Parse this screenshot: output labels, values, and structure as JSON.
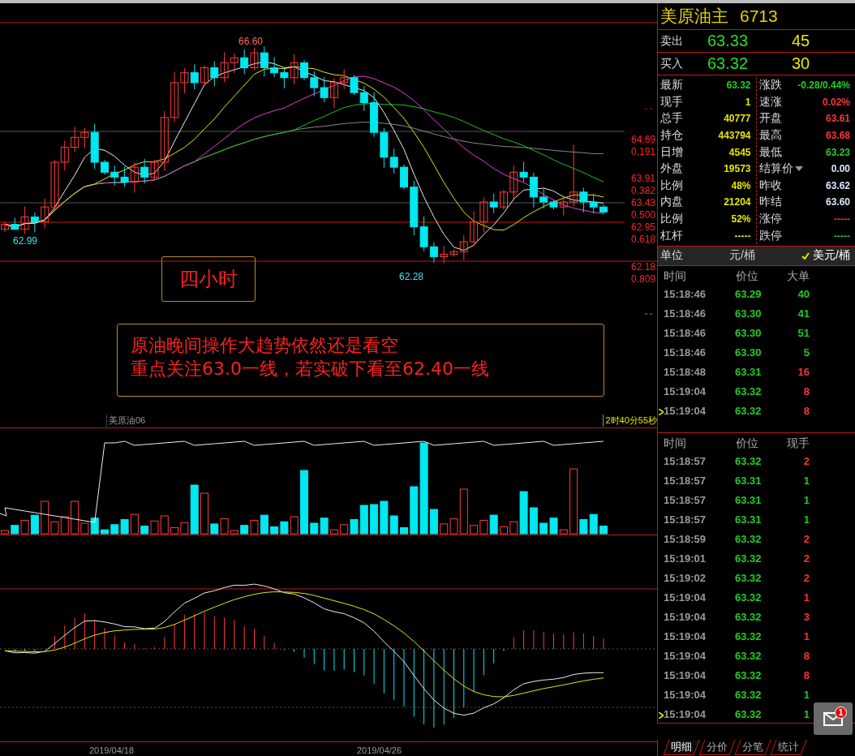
{
  "chart": {
    "extreme_labels": [
      {
        "kind": "high",
        "text": "66.60"
      },
      {
        "kind": "low",
        "text": "62.99"
      },
      {
        "kind": "low",
        "text": "62.28"
      }
    ],
    "fib_levels": [
      {
        "price": "64.69",
        "ratio": "0.191"
      },
      {
        "price": "63.91",
        "ratio": "0.382"
      },
      {
        "price": "63.43",
        "ratio": "0.500"
      },
      {
        "price": "62.95",
        "ratio": "0.618"
      },
      {
        "price": "62.18",
        "ratio": "0.809"
      }
    ],
    "timeframe_label": "四小时",
    "note_lines": [
      "原油晚间操作大趋势依然还是看空",
      "重点关注63.0一线，若实破下看至62.40一线"
    ]
  },
  "status_strip": {
    "symbol": "美原油06",
    "countdown": "2时40分55秒"
  },
  "date_axis": [
    "2019/04/18",
    "2019/04/26"
  ],
  "quote": {
    "name": "美原油主",
    "code": "6713",
    "ask": {
      "label": "卖出",
      "price": "63.33",
      "volume": "45"
    },
    "bid": {
      "label": "买入",
      "price": "63.32",
      "volume": "30"
    },
    "stats": [
      {
        "left": {
          "label": "最新",
          "value": "63.32",
          "color": "#22cc22"
        },
        "right": {
          "label": "涨跌",
          "value": "-0.28/0.44%",
          "color": "#22cc22",
          "kind": "plain"
        }
      },
      {
        "left": {
          "label": "现手",
          "value": "1",
          "color": "#e6e600"
        },
        "right": {
          "label": "速涨",
          "value": "0.02%",
          "color": "#ff3333",
          "kind": "plain"
        }
      },
      {
        "left": {
          "label": "总手",
          "value": "40777",
          "color": "#e6e600"
        },
        "right": {
          "label": "开盘",
          "value": "63.61",
          "color": "#ff3333",
          "kind": "plain"
        }
      },
      {
        "left": {
          "label": "持仓",
          "value": "443794",
          "color": "#e6e600"
        },
        "right": {
          "label": "最高",
          "value": "63.68",
          "color": "#ff3333",
          "kind": "plain"
        }
      },
      {
        "left": {
          "label": "日增",
          "value": "4545",
          "color": "#e6e600"
        },
        "right": {
          "label": "最低",
          "value": "63.23",
          "color": "#22cc22",
          "kind": "plain"
        }
      },
      {
        "left": {
          "label": "外盘",
          "value": "19573",
          "color": "#e6e600"
        },
        "right": {
          "label": "结算价",
          "value": "0.00",
          "color": "#dce8ff",
          "kind": "dropdown"
        }
      },
      {
        "left": {
          "label": "比例",
          "value": "48%",
          "color": "#e6e600"
        },
        "right": {
          "label": "昨收",
          "value": "63.62",
          "color": "#dce8ff",
          "kind": "plain"
        }
      },
      {
        "left": {
          "label": "内盘",
          "value": "21204",
          "color": "#e6e600"
        },
        "right": {
          "label": "昨结",
          "value": "63.60",
          "color": "#dce8ff",
          "kind": "plain"
        }
      },
      {
        "left": {
          "label": "比例",
          "value": "52%",
          "color": "#e6e600"
        },
        "right": {
          "label": "涨停",
          "value": "-----",
          "color": "#ff3333",
          "kind": "plain"
        }
      },
      {
        "left": {
          "label": "杠杆",
          "value": "-----",
          "color": "#e6e600"
        },
        "right": {
          "label": "跌停",
          "value": "-----",
          "color": "#22cc22",
          "kind": "plain"
        }
      }
    ],
    "unit": {
      "label": "单位",
      "options": [
        {
          "label": "元/桶",
          "selected": false
        },
        {
          "label": "美元/桶",
          "selected": true
        }
      ]
    }
  },
  "big_orders": {
    "columns": [
      "时间",
      "价位",
      "大单"
    ],
    "rows": [
      {
        "time": "15:18:46",
        "price": "63.29",
        "qty": "40",
        "color": "#22cc22",
        "current": false
      },
      {
        "time": "15:18:46",
        "price": "63.30",
        "qty": "41",
        "color": "#22cc22",
        "current": false
      },
      {
        "time": "15:18:46",
        "price": "63.30",
        "qty": "51",
        "color": "#22cc22",
        "current": false
      },
      {
        "time": "15:18:46",
        "price": "63.30",
        "qty": "5",
        "color": "#22cc22",
        "current": false
      },
      {
        "time": "15:18:48",
        "price": "63.31",
        "qty": "16",
        "color": "#ff3333",
        "current": false
      },
      {
        "time": "15:19:04",
        "price": "63.32",
        "qty": "8",
        "color": "#ff3333",
        "current": false
      },
      {
        "time": "15:19:04",
        "price": "63.32",
        "qty": "8",
        "color": "#ff3333",
        "current": true
      }
    ]
  },
  "ticks": {
    "columns": [
      "时间",
      "价位",
      "现手"
    ],
    "rows": [
      {
        "time": "15:18:57",
        "price": "63.32",
        "qty": "2",
        "color": "#ff3333",
        "current": false
      },
      {
        "time": "15:18:57",
        "price": "63.31",
        "qty": "1",
        "color": "#22cc22",
        "current": false
      },
      {
        "time": "15:18:57",
        "price": "63.31",
        "qty": "1",
        "color": "#22cc22",
        "current": false
      },
      {
        "time": "15:18:57",
        "price": "63.31",
        "qty": "1",
        "color": "#22cc22",
        "current": false
      },
      {
        "time": "15:18:59",
        "price": "63.32",
        "qty": "2",
        "color": "#ff3333",
        "current": false
      },
      {
        "time": "15:19:01",
        "price": "63.32",
        "qty": "2",
        "color": "#ff3333",
        "current": false
      },
      {
        "time": "15:19:02",
        "price": "63.32",
        "qty": "2",
        "color": "#ff3333",
        "current": false
      },
      {
        "time": "15:19:04",
        "price": "63.32",
        "qty": "1",
        "color": "#ff3333",
        "current": false
      },
      {
        "time": "15:19:04",
        "price": "63.32",
        "qty": "3",
        "color": "#ff3333",
        "current": false
      },
      {
        "time": "15:19:04",
        "price": "63.32",
        "qty": "1",
        "color": "#ff3333",
        "current": false
      },
      {
        "time": "15:19:04",
        "price": "63.32",
        "qty": "8",
        "color": "#ff3333",
        "current": false
      },
      {
        "time": "15:19:04",
        "price": "63.32",
        "qty": "8",
        "color": "#ff3333",
        "current": false
      },
      {
        "time": "15:19:04",
        "price": "63.32",
        "qty": "1",
        "color": "#22cc22",
        "current": false
      },
      {
        "time": "15:19:04",
        "price": "63.32",
        "qty": "1",
        "color": "#22cc22",
        "current": true
      }
    ]
  },
  "bottom_tabs": [
    {
      "label": "明细",
      "selected": true
    },
    {
      "label": "分价",
      "selected": false
    },
    {
      "label": "分笔",
      "selected": false
    },
    {
      "label": "统计",
      "selected": false
    }
  ],
  "notification": {
    "count": "1"
  }
}
